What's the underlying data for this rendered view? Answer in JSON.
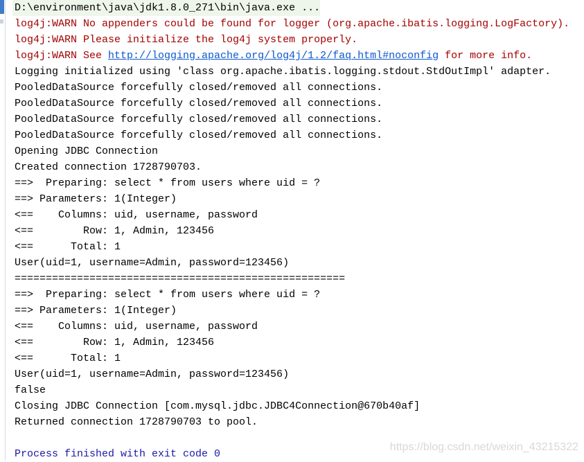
{
  "sidebar": {
    "icons": [
      "run-tab-icon",
      "tool-icon"
    ]
  },
  "console": {
    "command": "D:\\environment\\java\\jdk1.8.0_271\\bin\\java.exe ...",
    "warn1": "log4j:WARN No appenders could be found for logger (org.apache.ibatis.logging.LogFactory).",
    "warn2": "log4j:WARN Please initialize the log4j system properly.",
    "warn3_prefix": "log4j:WARN See ",
    "warn3_link": "http://logging.apache.org/log4j/1.2/faq.html#noconfig",
    "warn3_suffix": " for more info.",
    "lines": [
      "Logging initialized using 'class org.apache.ibatis.logging.stdout.StdOutImpl' adapter.",
      "PooledDataSource forcefully closed/removed all connections.",
      "PooledDataSource forcefully closed/removed all connections.",
      "PooledDataSource forcefully closed/removed all connections.",
      "PooledDataSource forcefully closed/removed all connections.",
      "Opening JDBC Connection",
      "Created connection 1728790703.",
      "==>  Preparing: select * from users where uid = ?",
      "==> Parameters: 1(Integer)",
      "<==    Columns: uid, username, password",
      "<==        Row: 1, Admin, 123456",
      "<==      Total: 1",
      "User(uid=1, username=Admin, password=123456)",
      "=====================================================",
      "==>  Preparing: select * from users where uid = ?",
      "==> Parameters: 1(Integer)",
      "<==    Columns: uid, username, password",
      "<==        Row: 1, Admin, 123456",
      "<==      Total: 1",
      "User(uid=1, username=Admin, password=123456)",
      "false",
      "Closing JDBC Connection [com.mysql.jdbc.JDBC4Connection@670b40af]",
      "Returned connection 1728790703 to pool.",
      ""
    ],
    "exit": "Process finished with exit code 0"
  },
  "watermark": "https://blog.csdn.net/weixin_43215322",
  "colors": {
    "warn": "#a40000",
    "link": "#0b57d0",
    "exit": "#1a1aa6",
    "command_bg": "#eef5ea"
  }
}
